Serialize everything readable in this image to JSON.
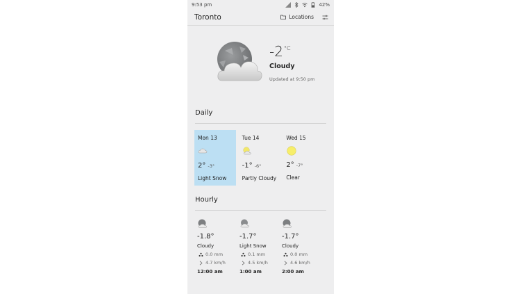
{
  "status": {
    "time": "9:53 pm",
    "battery": "42%"
  },
  "header": {
    "city": "Toronto",
    "locations_label": "Locations"
  },
  "current": {
    "temp": "-2",
    "unit": "°C",
    "condition": "Cloudy",
    "updated": "Updated at 9:50 pm",
    "icon": "moon-cloud-icon"
  },
  "daily": {
    "title": "Daily",
    "days": [
      {
        "name": "Mon 13",
        "hi": "2°",
        "lo": "-3°",
        "cond": "Light Snow",
        "icon": "snow-cloud-icon",
        "selected": true
      },
      {
        "name": "Tue 14",
        "hi": "-1°",
        "lo": "-6°",
        "cond": "Partly Cloudy",
        "icon": "sun-cloud-icon",
        "selected": false
      },
      {
        "name": "Wed 15",
        "hi": "2°",
        "lo": "-7°",
        "cond": "Clear",
        "icon": "sun-icon",
        "selected": false
      }
    ]
  },
  "hourly": {
    "title": "Hourly",
    "hours": [
      {
        "temp": "-1.8°",
        "cond": "Cloudy",
        "precip": "0.0 mm",
        "wind": "4.7 km/h",
        "time": "12:00 am",
        "icon": "moon-cloud-icon"
      },
      {
        "temp": "-1.7°",
        "cond": "Light Snow",
        "precip": "0.1 mm",
        "wind": "4.5 km/h",
        "time": "1:00 am",
        "icon": "snow-cloud-icon"
      },
      {
        "temp": "-1.7°",
        "cond": "Cloudy",
        "precip": "0.0 mm",
        "wind": "4.6 km/h",
        "time": "2:00 am",
        "icon": "moon-cloud-icon"
      }
    ]
  },
  "colors": {
    "selected_day": "#bcdff3",
    "background": "#eeeeef",
    "sun": "#f7ee6a"
  }
}
